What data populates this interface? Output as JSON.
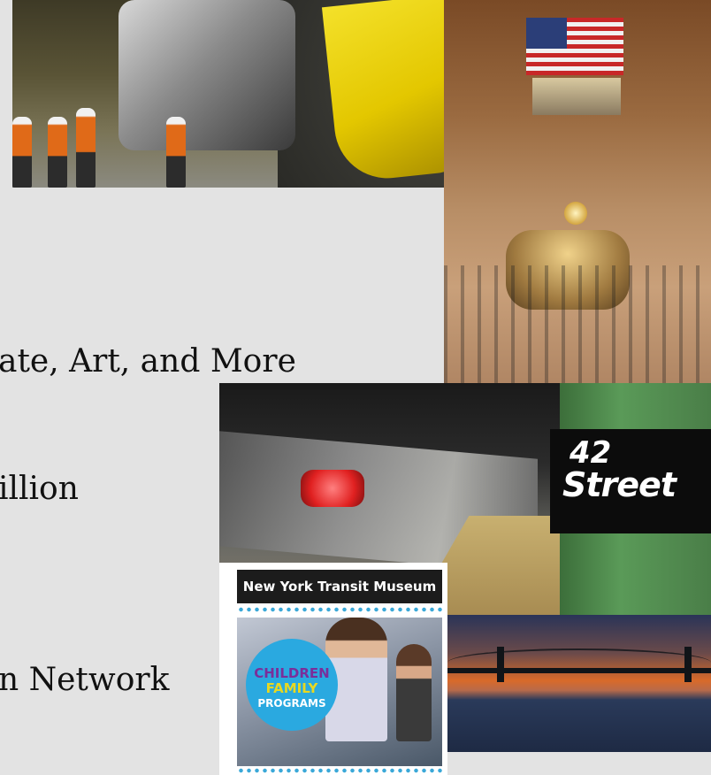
{
  "slide": {
    "lines": [
      "ate, Art, and More",
      "illion",
      "n Network"
    ]
  },
  "photos": {
    "subway_sign": {
      "number": "42",
      "word": "Street"
    },
    "museum_poster": {
      "header": "New York Transit Museum",
      "badge_line1": "CHILDREN",
      "badge_line2": "FAMILY",
      "badge_line3": "PROGRAMS"
    }
  },
  "colors": {
    "background": "#e3e3e3",
    "text": "#111111"
  }
}
